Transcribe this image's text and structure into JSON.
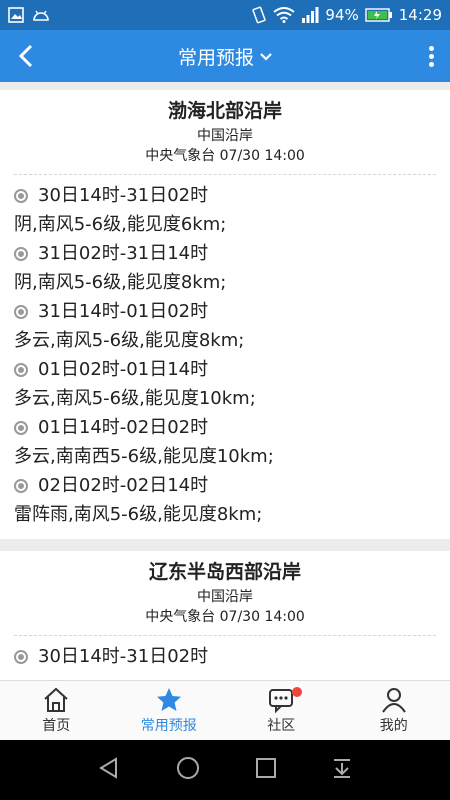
{
  "status_bar": {
    "battery": "94%",
    "time": "14:29"
  },
  "app_bar": {
    "title": "常用预报"
  },
  "cards": [
    {
      "title": "渤海北部沿岸",
      "subtitle": "中国沿岸",
      "source": "中央气象台 07/30 14:00",
      "entries": [
        {
          "period": "30日14时-31日02时",
          "desc": "阴,南风5-6级,能见度6km;"
        },
        {
          "period": "31日02时-31日14时",
          "desc": "阴,南风5-6级,能见度8km;"
        },
        {
          "period": "31日14时-01日02时",
          "desc": "多云,南风5-6级,能见度8km;"
        },
        {
          "period": "01日02时-01日14时",
          "desc": "多云,南风5-6级,能见度10km;"
        },
        {
          "period": "01日14时-02日02时",
          "desc": "多云,南南西5-6级,能见度10km;"
        },
        {
          "period": "02日02时-02日14时",
          "desc": "雷阵雨,南风5-6级,能见度8km;"
        }
      ]
    },
    {
      "title": "辽东半岛西部沿岸",
      "subtitle": "中国沿岸",
      "source": "中央气象台 07/30 14:00",
      "entries": [
        {
          "period": "30日14时-31日02时",
          "desc": ""
        }
      ]
    }
  ],
  "bottom_nav": {
    "items": [
      {
        "label": "首页",
        "icon": "home-icon"
      },
      {
        "label": "常用预报",
        "icon": "star-icon"
      },
      {
        "label": "社区",
        "icon": "chat-icon"
      },
      {
        "label": "我的",
        "icon": "person-icon"
      }
    ]
  },
  "colors": {
    "status_bar": "#1f6fb8",
    "app_bar": "#2e8ae0",
    "active": "#2e8ae0",
    "badge": "#f0453a"
  }
}
